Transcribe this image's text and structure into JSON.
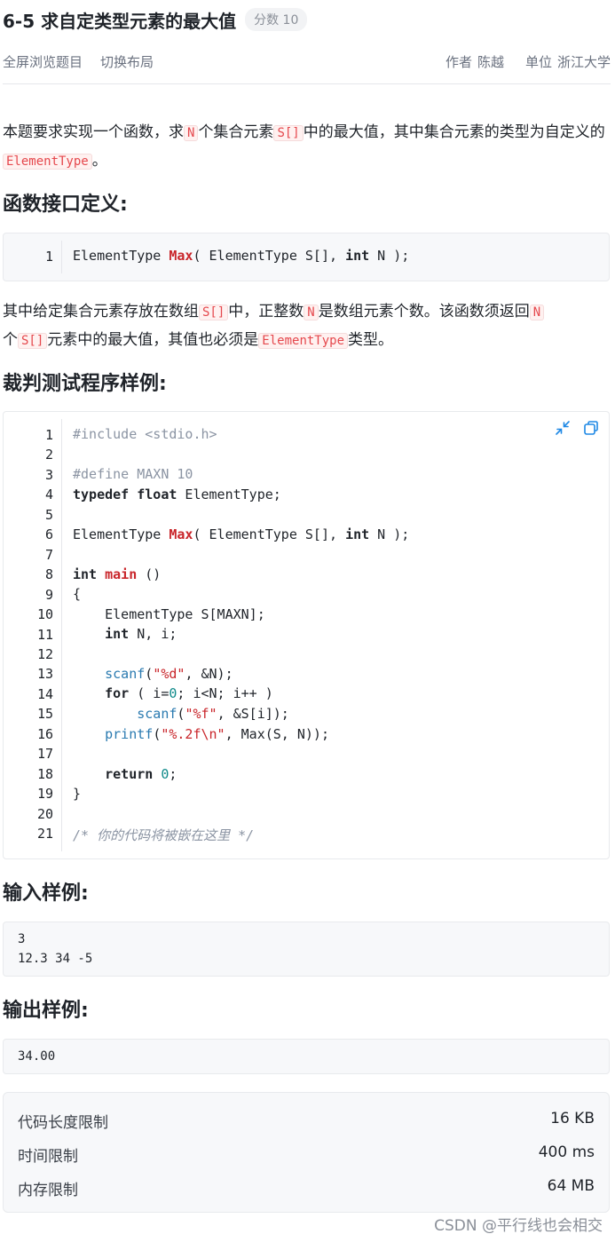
{
  "problem": {
    "title": "6-5 求自定类型元素的最大值",
    "score_badge": "分数 10"
  },
  "toolbar": {
    "fullscreen": "全屏浏览题目",
    "switch_layout": "切换布局",
    "author_label": "作者",
    "author": "陈越",
    "unit_label": "单位",
    "unit": "浙江大学"
  },
  "description": {
    "p1_a": "本题要求实现一个函数，求",
    "p1_code1": "N",
    "p1_b": "个集合元素",
    "p1_code2": "S[]",
    "p1_c": "中的最大值，其中集合元素的类型为自定义的",
    "p1_code3": "ElementType",
    "p1_d": "。",
    "heading_interface": "函数接口定义:",
    "p2_a": "其中给定集合元素存放在数组",
    "p2_code1": "S[]",
    "p2_b": "中，正整数",
    "p2_code2": "N",
    "p2_c": "是数组元素个数。该函数须返回",
    "p2_code3": "N",
    "p2_d": "个",
    "p2_code4": "S[]",
    "p2_e": "元素中的最大值，其值也必须是",
    "p2_code5": "ElementType",
    "p2_f": "类型。",
    "heading_sample_program": "裁判测试程序样例:",
    "heading_input": "输入样例:",
    "heading_output": "输出样例:"
  },
  "interface_code": {
    "line_number": "1",
    "t1": "ElementType ",
    "fn": "Max",
    "t2": "( ElementType S[], ",
    "kw": "int",
    "t3": " N );"
  },
  "sample_program": {
    "line_numbers": [
      "1",
      "2",
      "3",
      "4",
      "5",
      "6",
      "7",
      "8",
      "9",
      "10",
      "11",
      "12",
      "13",
      "14",
      "15",
      "16",
      "17",
      "18",
      "19",
      "20",
      "21"
    ],
    "l1": "#include <stdio.h>",
    "l3": "#define MAXN 10",
    "l4_kw1": "typedef",
    "l4_kw2": "float",
    "l4_rest": " ElementType;",
    "l6_a": "ElementType ",
    "l6_fn": "Max",
    "l6_b": "( ElementType S[], ",
    "l6_kw": "int",
    "l6_c": " N );",
    "l8_kw": "int",
    "l8_fn": "main",
    "l8_rest": " ()",
    "l9": "{",
    "l10": "    ElementType S[MAXN];",
    "l11_kw": "int",
    "l11_rest": " N, i;",
    "l13_call": "scanf",
    "l13_a": "(",
    "l13_str": "\"%d\"",
    "l13_b": ", &N);",
    "l14_kw": "for",
    "l14_a": " ( i=",
    "l14_n": "0",
    "l14_b": "; i<N; i++ )",
    "l15_call": "scanf",
    "l15_a": "(",
    "l15_str": "\"%f\"",
    "l15_b": ", &S[i]);",
    "l16_call": "printf",
    "l16_a": "(",
    "l16_str": "\"%.2f\\n\"",
    "l16_b": ", Max(S, N));",
    "l18_kw": "return",
    "l18_n": "0",
    "l18_rest": ";",
    "l19": "}",
    "l21": "/* 你的代码将被嵌在这里 */"
  },
  "icons": {
    "collapse": "collapse-icon",
    "copy": "copy-icon",
    "accent": "#1e88e5"
  },
  "sample_input": "3\n12.3 34 -5",
  "sample_output": "34.00",
  "limits": [
    {
      "label": "代码长度限制",
      "value": "16 KB"
    },
    {
      "label": "时间限制",
      "value": "400 ms"
    },
    {
      "label": "内存限制",
      "value": "64 MB"
    }
  ],
  "watermark": "CSDN @平行线也会相交"
}
